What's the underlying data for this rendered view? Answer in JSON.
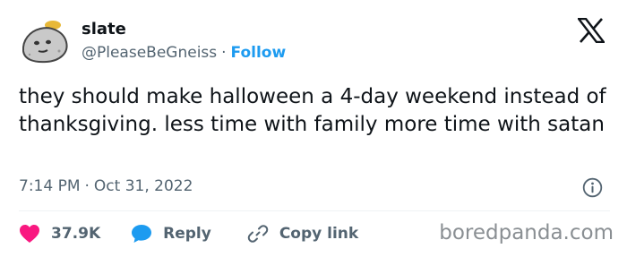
{
  "author": {
    "name": "slate",
    "handle": "@PleaseBeGneiss",
    "separator": "·",
    "follow_label": "Follow",
    "avatar_icon": "rock-avatar-icon"
  },
  "platform_icon": "x-logo-icon",
  "tweet": {
    "text": "they should make halloween a 4-day weekend instead of thanksgiving. less time with family more time with satan",
    "time": "7:14 PM",
    "separator": "·",
    "date": "Oct 31, 2022"
  },
  "actions": {
    "likes": "37.9K",
    "reply_label": "Reply",
    "copy_label": "Copy link"
  },
  "watermark": "boredpanda.com",
  "colors": {
    "accent": "#1d9bf0",
    "like": "#f91880",
    "text": "#0f1419",
    "muted": "#536471"
  }
}
